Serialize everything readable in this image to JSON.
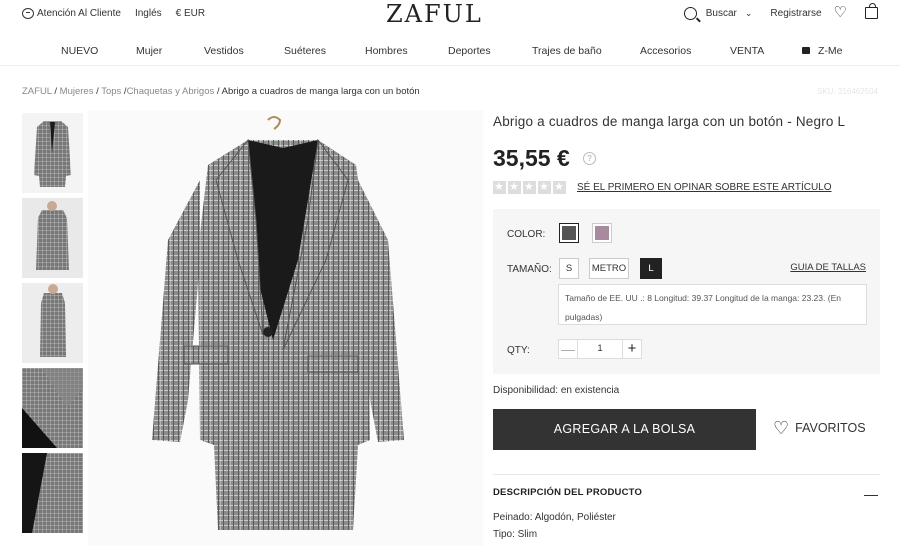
{
  "topbar": {
    "customer_service": "Atención Al Cliente",
    "language": "Inglés",
    "currency": "€ EUR",
    "logo": "ZAFUL",
    "search_label": "Buscar",
    "search_chevron": "⌄",
    "register": "Registrarse",
    "icons": [
      "chat-icon",
      "search-icon",
      "heart-icon",
      "bag-icon"
    ]
  },
  "nav": {
    "items": [
      "NUEVO",
      "Mujer",
      "Vestidos",
      "Suéteres",
      "Hombres",
      "Deportes",
      "Trajes de baño",
      "Accesorios",
      "VENTA",
      "Z-Me"
    ]
  },
  "breadcrumb": {
    "items": [
      "ZAFUL",
      "Mujeres",
      "Tops",
      "Chaquetas y Abrigos"
    ],
    "current": "Abrigo a cuadros de manga larga con un botón",
    "sku": "SKU: 316462504"
  },
  "product": {
    "title": "Abrigo a cuadros de manga larga con un botón - Negro L",
    "price": "35,55 €",
    "price_help": "?",
    "rating": 0,
    "rating_max": 5,
    "review_link": "SÉ EL PRIMERO EN OPINAR SOBRE ESTE ARTÍCULO",
    "color_label": "COLOR:",
    "colors": [
      {
        "name": "Negro",
        "hex": "#555555",
        "selected": true
      },
      {
        "name": "Rosa",
        "hex": "#a88a9e",
        "selected": false
      }
    ],
    "size_label": "TAMAÑO:",
    "sizes": [
      {
        "label": "S",
        "selected": false
      },
      {
        "label": "METRO",
        "selected": false
      },
      {
        "label": "L",
        "selected": true
      }
    ],
    "size_guide": "GUIA DE TALLAS",
    "size_info": "Tamaño de EE. UU .: 8 Longitud: 39.37 Longitud de la manga: 23.23. (En pulgadas)",
    "qty_label": "QTY:",
    "qty_minus": "—",
    "qty_value": "1",
    "qty_plus": "+",
    "availability": "Disponibilidad: en existencia",
    "add_to_bag": "AGREGAR A LA BOLSA",
    "favorites": "FAVORITOS",
    "favorites_icon": "♡",
    "description_title": "DESCRIPCIÓN DEL PRODUCTO",
    "description_toggle": "—",
    "description_lines": [
      "Peinado: Algodón, Poliéster",
      "Tipo: Slim"
    ]
  },
  "colors": {
    "dark_button": "#333333",
    "panel_bg": "#f6f6f6",
    "text": "#333333"
  }
}
